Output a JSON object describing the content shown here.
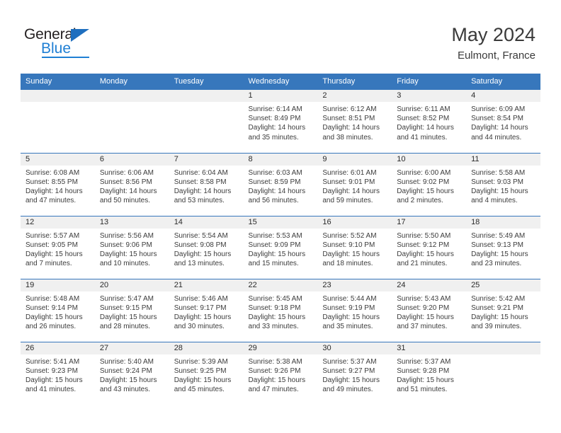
{
  "brand": {
    "name_top": "General",
    "name_bottom": "Blue",
    "accent_color": "#1f7fd4",
    "triangle_color": "#1f6fbf"
  },
  "header": {
    "month_title": "May 2024",
    "location": "Eulmont, France"
  },
  "calendar": {
    "header_bg": "#3777bc",
    "daynum_band_bg": "#f0f0f0",
    "weekdays": [
      "Sunday",
      "Monday",
      "Tuesday",
      "Wednesday",
      "Thursday",
      "Friday",
      "Saturday"
    ],
    "weeks": [
      [
        {
          "day": "",
          "empty": true
        },
        {
          "day": "",
          "empty": true
        },
        {
          "day": "",
          "empty": true
        },
        {
          "day": "1",
          "sunrise": "Sunrise: 6:14 AM",
          "sunset": "Sunset: 8:49 PM",
          "daylight": "Daylight: 14 hours and 35 minutes."
        },
        {
          "day": "2",
          "sunrise": "Sunrise: 6:12 AM",
          "sunset": "Sunset: 8:51 PM",
          "daylight": "Daylight: 14 hours and 38 minutes."
        },
        {
          "day": "3",
          "sunrise": "Sunrise: 6:11 AM",
          "sunset": "Sunset: 8:52 PM",
          "daylight": "Daylight: 14 hours and 41 minutes."
        },
        {
          "day": "4",
          "sunrise": "Sunrise: 6:09 AM",
          "sunset": "Sunset: 8:54 PM",
          "daylight": "Daylight: 14 hours and 44 minutes."
        }
      ],
      [
        {
          "day": "5",
          "sunrise": "Sunrise: 6:08 AM",
          "sunset": "Sunset: 8:55 PM",
          "daylight": "Daylight: 14 hours and 47 minutes."
        },
        {
          "day": "6",
          "sunrise": "Sunrise: 6:06 AM",
          "sunset": "Sunset: 8:56 PM",
          "daylight": "Daylight: 14 hours and 50 minutes."
        },
        {
          "day": "7",
          "sunrise": "Sunrise: 6:04 AM",
          "sunset": "Sunset: 8:58 PM",
          "daylight": "Daylight: 14 hours and 53 minutes."
        },
        {
          "day": "8",
          "sunrise": "Sunrise: 6:03 AM",
          "sunset": "Sunset: 8:59 PM",
          "daylight": "Daylight: 14 hours and 56 minutes."
        },
        {
          "day": "9",
          "sunrise": "Sunrise: 6:01 AM",
          "sunset": "Sunset: 9:01 PM",
          "daylight": "Daylight: 14 hours and 59 minutes."
        },
        {
          "day": "10",
          "sunrise": "Sunrise: 6:00 AM",
          "sunset": "Sunset: 9:02 PM",
          "daylight": "Daylight: 15 hours and 2 minutes."
        },
        {
          "day": "11",
          "sunrise": "Sunrise: 5:58 AM",
          "sunset": "Sunset: 9:03 PM",
          "daylight": "Daylight: 15 hours and 4 minutes."
        }
      ],
      [
        {
          "day": "12",
          "sunrise": "Sunrise: 5:57 AM",
          "sunset": "Sunset: 9:05 PM",
          "daylight": "Daylight: 15 hours and 7 minutes."
        },
        {
          "day": "13",
          "sunrise": "Sunrise: 5:56 AM",
          "sunset": "Sunset: 9:06 PM",
          "daylight": "Daylight: 15 hours and 10 minutes."
        },
        {
          "day": "14",
          "sunrise": "Sunrise: 5:54 AM",
          "sunset": "Sunset: 9:08 PM",
          "daylight": "Daylight: 15 hours and 13 minutes."
        },
        {
          "day": "15",
          "sunrise": "Sunrise: 5:53 AM",
          "sunset": "Sunset: 9:09 PM",
          "daylight": "Daylight: 15 hours and 15 minutes."
        },
        {
          "day": "16",
          "sunrise": "Sunrise: 5:52 AM",
          "sunset": "Sunset: 9:10 PM",
          "daylight": "Daylight: 15 hours and 18 minutes."
        },
        {
          "day": "17",
          "sunrise": "Sunrise: 5:50 AM",
          "sunset": "Sunset: 9:12 PM",
          "daylight": "Daylight: 15 hours and 21 minutes."
        },
        {
          "day": "18",
          "sunrise": "Sunrise: 5:49 AM",
          "sunset": "Sunset: 9:13 PM",
          "daylight": "Daylight: 15 hours and 23 minutes."
        }
      ],
      [
        {
          "day": "19",
          "sunrise": "Sunrise: 5:48 AM",
          "sunset": "Sunset: 9:14 PM",
          "daylight": "Daylight: 15 hours and 26 minutes."
        },
        {
          "day": "20",
          "sunrise": "Sunrise: 5:47 AM",
          "sunset": "Sunset: 9:15 PM",
          "daylight": "Daylight: 15 hours and 28 minutes."
        },
        {
          "day": "21",
          "sunrise": "Sunrise: 5:46 AM",
          "sunset": "Sunset: 9:17 PM",
          "daylight": "Daylight: 15 hours and 30 minutes."
        },
        {
          "day": "22",
          "sunrise": "Sunrise: 5:45 AM",
          "sunset": "Sunset: 9:18 PM",
          "daylight": "Daylight: 15 hours and 33 minutes."
        },
        {
          "day": "23",
          "sunrise": "Sunrise: 5:44 AM",
          "sunset": "Sunset: 9:19 PM",
          "daylight": "Daylight: 15 hours and 35 minutes."
        },
        {
          "day": "24",
          "sunrise": "Sunrise: 5:43 AM",
          "sunset": "Sunset: 9:20 PM",
          "daylight": "Daylight: 15 hours and 37 minutes."
        },
        {
          "day": "25",
          "sunrise": "Sunrise: 5:42 AM",
          "sunset": "Sunset: 9:21 PM",
          "daylight": "Daylight: 15 hours and 39 minutes."
        }
      ],
      [
        {
          "day": "26",
          "sunrise": "Sunrise: 5:41 AM",
          "sunset": "Sunset: 9:23 PM",
          "daylight": "Daylight: 15 hours and 41 minutes."
        },
        {
          "day": "27",
          "sunrise": "Sunrise: 5:40 AM",
          "sunset": "Sunset: 9:24 PM",
          "daylight": "Daylight: 15 hours and 43 minutes."
        },
        {
          "day": "28",
          "sunrise": "Sunrise: 5:39 AM",
          "sunset": "Sunset: 9:25 PM",
          "daylight": "Daylight: 15 hours and 45 minutes."
        },
        {
          "day": "29",
          "sunrise": "Sunrise: 5:38 AM",
          "sunset": "Sunset: 9:26 PM",
          "daylight": "Daylight: 15 hours and 47 minutes."
        },
        {
          "day": "30",
          "sunrise": "Sunrise: 5:37 AM",
          "sunset": "Sunset: 9:27 PM",
          "daylight": "Daylight: 15 hours and 49 minutes."
        },
        {
          "day": "31",
          "sunrise": "Sunrise: 5:37 AM",
          "sunset": "Sunset: 9:28 PM",
          "daylight": "Daylight: 15 hours and 51 minutes."
        },
        {
          "day": "",
          "empty": true
        }
      ]
    ]
  }
}
